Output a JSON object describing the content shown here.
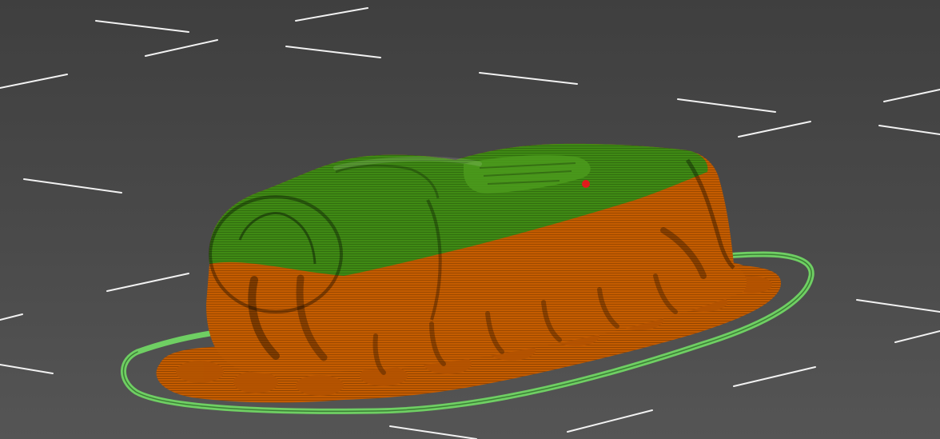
{
  "viewport": {
    "background_color": "#4a4a4a",
    "grid_line_color": "#f2f2f2",
    "view": "3d-perspective"
  },
  "preview": {
    "mode": "sliced-layer-preview",
    "colors": {
      "upper_shell": "#3f8a14",
      "lower_shell": "#c45c00",
      "skirt_outline": "#6fcf63",
      "seam_marker": "#e11b1b"
    },
    "objects": [
      "model",
      "support",
      "skirt",
      "seam-marker"
    ]
  }
}
